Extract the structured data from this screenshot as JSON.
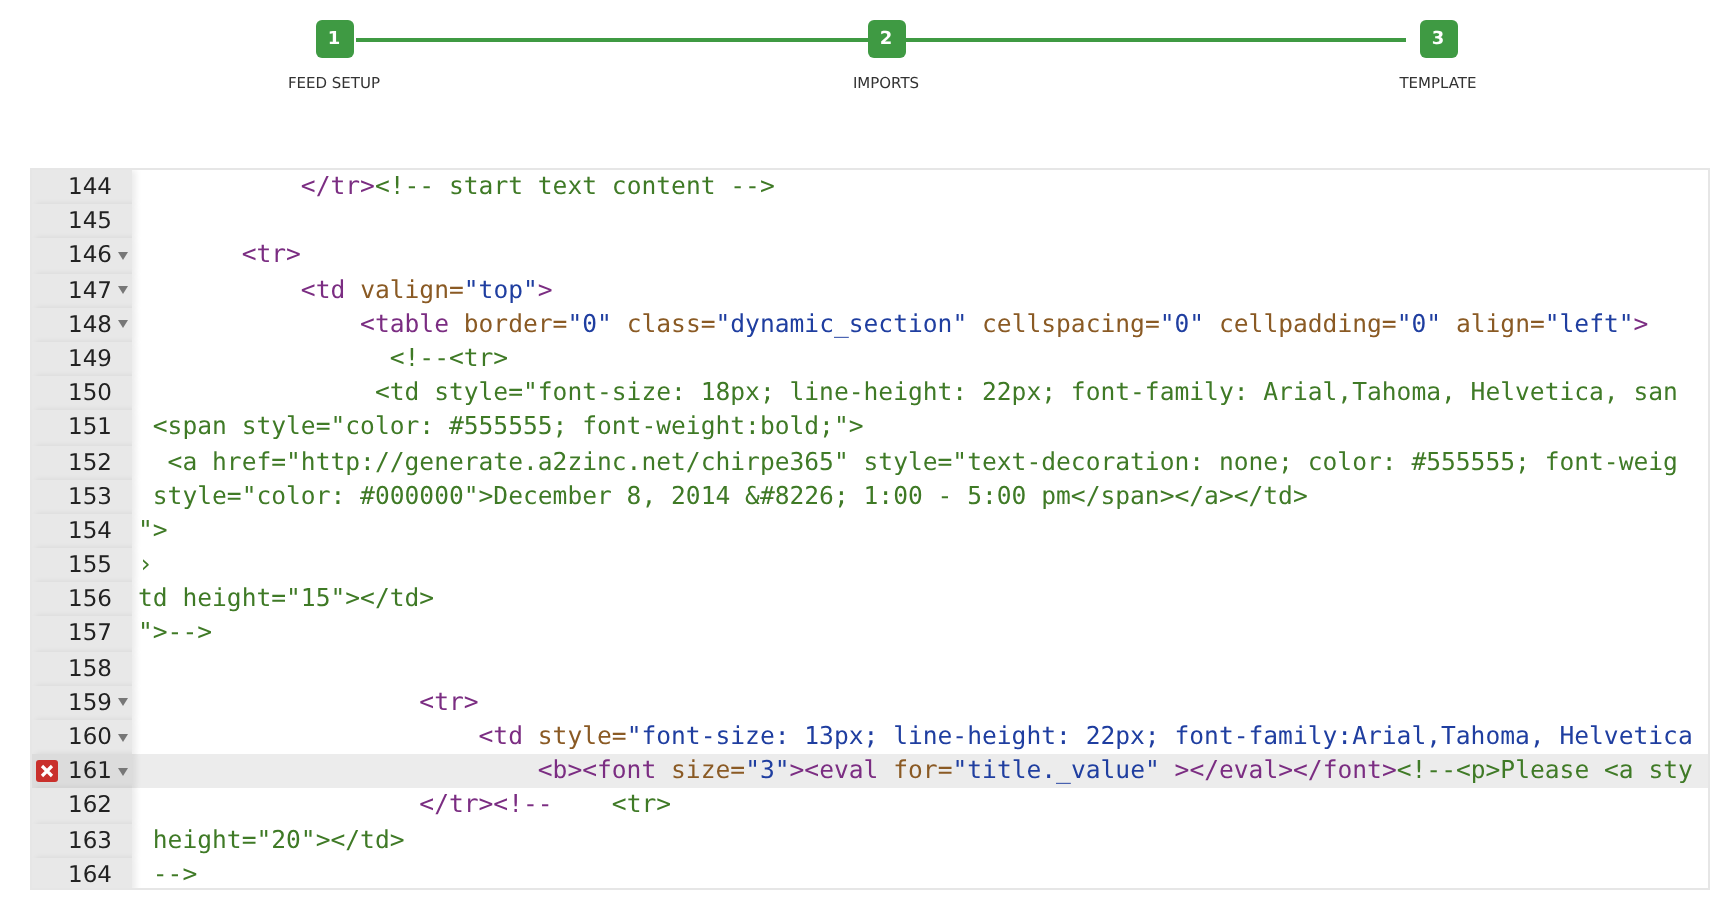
{
  "steps": [
    {
      "number": "1",
      "label": "FEED SETUP"
    },
    {
      "number": "2",
      "label": "IMPORTS"
    },
    {
      "number": "3",
      "label": "TEMPLATE"
    }
  ],
  "editor": {
    "lines": [
      {
        "number": "144",
        "fold": false,
        "error": false,
        "selected": false,
        "segments": [
          {
            "kind": "tag",
            "text": "           </tr>"
          },
          {
            "kind": "comment",
            "text": "<!-- start text content -->"
          }
        ]
      },
      {
        "number": "145",
        "fold": false,
        "error": false,
        "selected": false
      },
      {
        "number": "146",
        "fold": true,
        "error": false,
        "selected": false,
        "segments": [
          {
            "kind": "tag",
            "text": "       <tr>"
          }
        ]
      },
      {
        "number": "147",
        "fold": true,
        "error": false,
        "selected": false,
        "segments": [
          {
            "kind": "tag",
            "text": "           <td "
          },
          {
            "kind": "attr",
            "text": "valign="
          },
          {
            "kind": "string",
            "text": "\"top\""
          },
          {
            "kind": "tag",
            "text": ">"
          }
        ]
      },
      {
        "number": "148",
        "fold": true,
        "error": false,
        "selected": false,
        "segments": [
          {
            "kind": "tag",
            "text": "               <table "
          },
          {
            "kind": "attr",
            "text": "border="
          },
          {
            "kind": "string",
            "text": "\"0\""
          },
          {
            "kind": "attr",
            "text": " class="
          },
          {
            "kind": "string",
            "text": "\"dynamic_section\""
          },
          {
            "kind": "attr",
            "text": " cellspacing="
          },
          {
            "kind": "string",
            "text": "\"0\""
          },
          {
            "kind": "attr",
            "text": " cellpadding="
          },
          {
            "kind": "string",
            "text": "\"0\""
          },
          {
            "kind": "attr",
            "text": " align="
          },
          {
            "kind": "string",
            "text": "\"left\""
          },
          {
            "kind": "tag",
            "text": ">"
          }
        ]
      },
      {
        "number": "149",
        "fold": false,
        "error": false,
        "selected": false,
        "segments": [
          {
            "kind": "comment",
            "text": "                 <!--<tr>"
          }
        ]
      },
      {
        "number": "150",
        "fold": false,
        "error": false,
        "selected": false,
        "segments": [
          {
            "kind": "comment",
            "text": "                <td style=\"font-size: 18px; line-height: 22px; font-family: Arial,Tahoma, Helvetica, san"
          }
        ]
      },
      {
        "number": "151",
        "fold": false,
        "error": false,
        "selected": false,
        "segments": [
          {
            "kind": "comment",
            "text": " <span style=\"color: #555555; font-weight:bold;\">"
          }
        ]
      },
      {
        "number": "152",
        "fold": false,
        "error": false,
        "selected": false,
        "segments": [
          {
            "kind": "comment",
            "text": "  <a href=\"http://generate.a2zinc.net/chirpe365\" style=\"text-decoration: none; color: #555555; font-weig"
          }
        ]
      },
      {
        "number": "153",
        "fold": false,
        "error": false,
        "selected": false,
        "segments": [
          {
            "kind": "comment",
            "text": " style=\"color: #000000\">December 8, 2014 &#8226; 1:00 - 5:00 pm</span></a></td>"
          }
        ]
      },
      {
        "number": "154",
        "fold": false,
        "error": false,
        "selected": false,
        "segments": [
          {
            "kind": "comment",
            "text": "\">"
          }
        ]
      },
      {
        "number": "155",
        "fold": false,
        "error": false,
        "selected": false,
        "segments": [
          {
            "kind": "comment",
            "text": "›"
          }
        ]
      },
      {
        "number": "156",
        "fold": false,
        "error": false,
        "selected": false,
        "segments": [
          {
            "kind": "comment",
            "text": "td height=\"15\"></td>"
          }
        ]
      },
      {
        "number": "157",
        "fold": false,
        "error": false,
        "selected": false,
        "segments": [
          {
            "kind": "comment",
            "text": "\">-->"
          }
        ]
      },
      {
        "number": "158",
        "fold": false,
        "error": false,
        "selected": false
      },
      {
        "number": "159",
        "fold": true,
        "error": false,
        "selected": false,
        "segments": [
          {
            "kind": "tag",
            "text": "                   <tr>"
          }
        ]
      },
      {
        "number": "160",
        "fold": true,
        "error": false,
        "selected": false,
        "segments": [
          {
            "kind": "tag",
            "text": "                       <td "
          },
          {
            "kind": "attr",
            "text": "style="
          },
          {
            "kind": "string",
            "text": "\"font-size: 13px; line-height: 22px; font-family:Arial,Tahoma, Helvetica"
          }
        ]
      },
      {
        "number": "161",
        "fold": true,
        "error": true,
        "selected": true,
        "segments": [
          {
            "kind": "tag",
            "text": "                           <b><font "
          },
          {
            "kind": "attr",
            "text": "size="
          },
          {
            "kind": "string",
            "text": "\"3\""
          },
          {
            "kind": "tag",
            "text": "><eval "
          },
          {
            "kind": "attr",
            "text": "for="
          },
          {
            "kind": "string",
            "text": "\"title._value\""
          },
          {
            "kind": "tag",
            "text": " ></eval></font>"
          },
          {
            "kind": "comment",
            "text": "<!--<p>Please <a sty"
          }
        ]
      },
      {
        "number": "162",
        "fold": false,
        "error": false,
        "selected": false,
        "segments": [
          {
            "kind": "tag",
            "text": "                   </tr><!--"
          },
          {
            "kind": "comment",
            "text": "    <tr>"
          }
        ]
      },
      {
        "number": "163",
        "fold": false,
        "error": false,
        "selected": false,
        "segments": [
          {
            "kind": "comment",
            "text": " height=\"20\"></td>"
          }
        ]
      },
      {
        "number": "164",
        "fold": false,
        "error": false,
        "selected": false,
        "segments": [
          {
            "kind": "comment",
            "text": " -->"
          }
        ]
      }
    ]
  }
}
